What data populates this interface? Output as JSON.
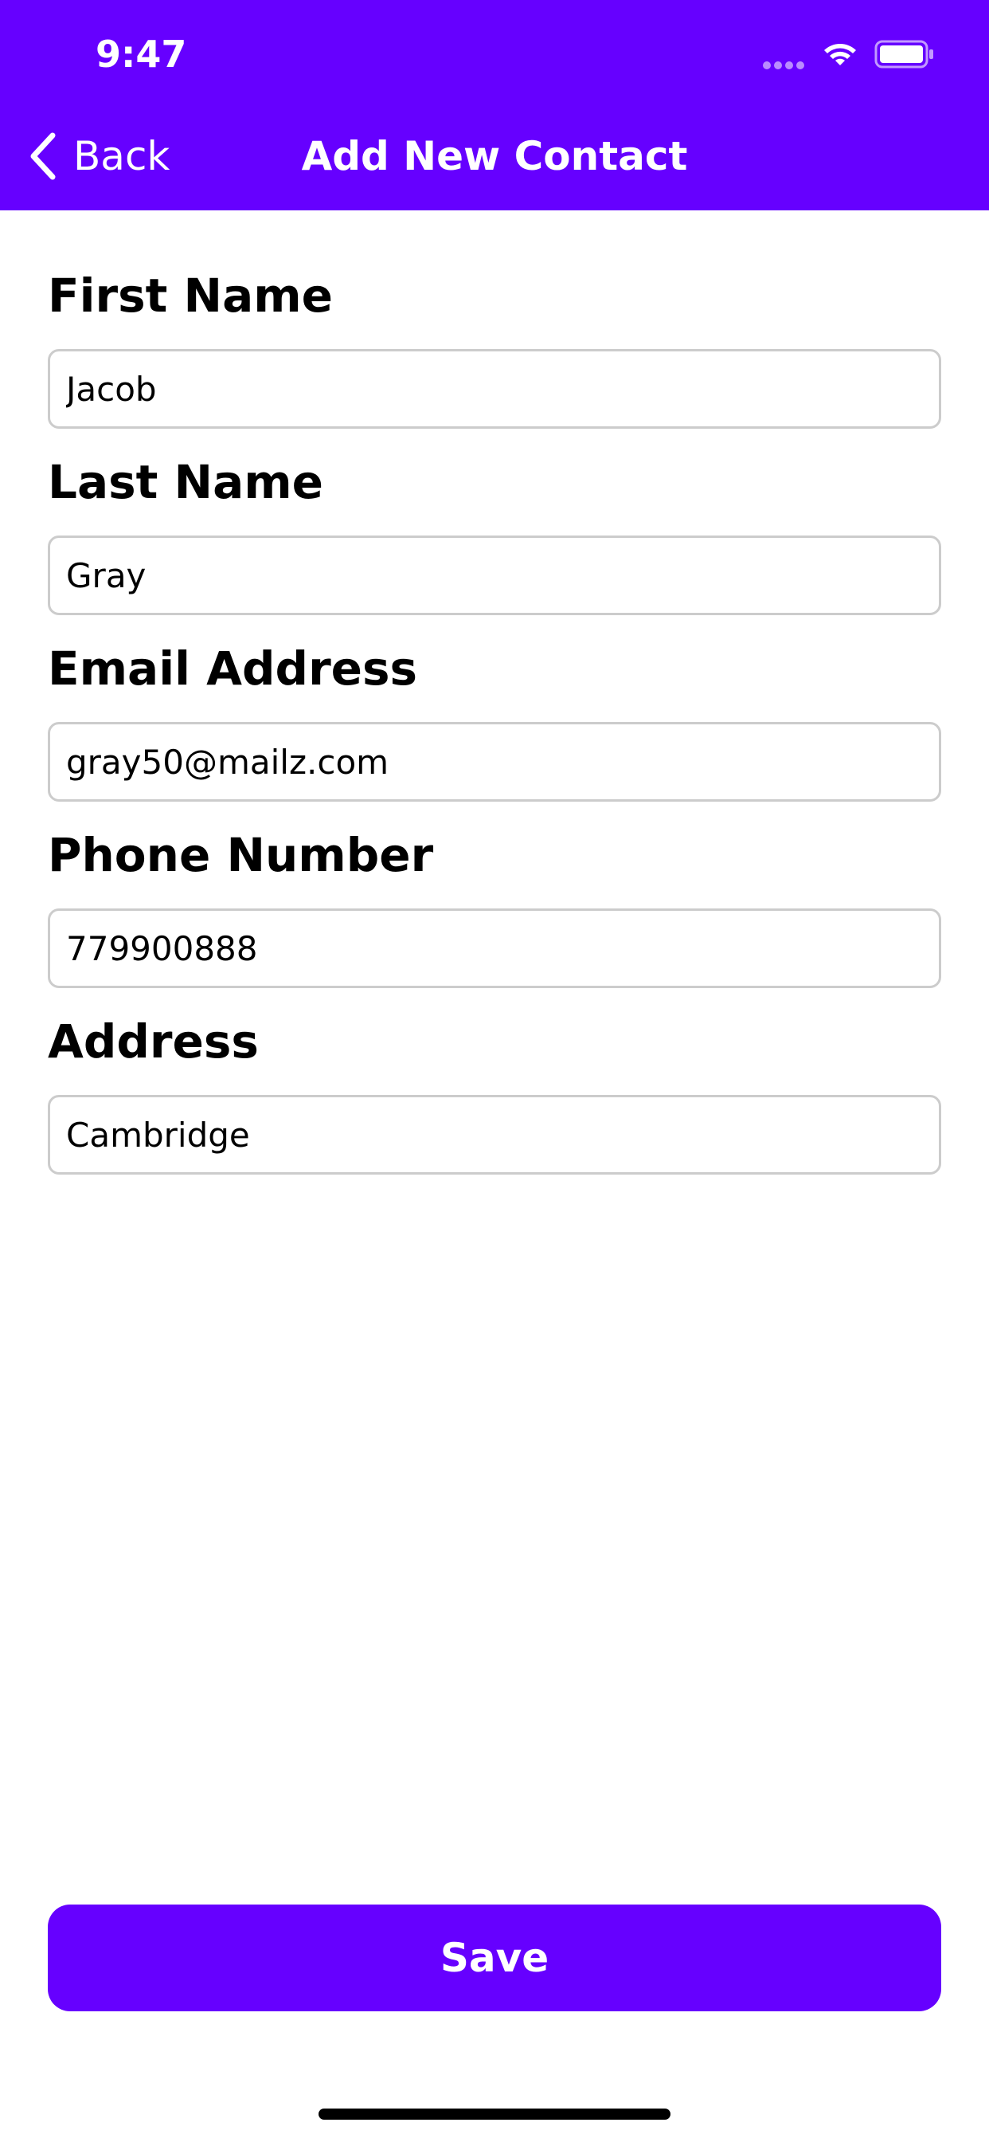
{
  "status_bar": {
    "time": "9:47"
  },
  "nav": {
    "back_label": "Back",
    "title": "Add New Contact"
  },
  "form": {
    "fields": [
      {
        "label": "First Name",
        "value": "Jacob"
      },
      {
        "label": "Last Name",
        "value": "Gray"
      },
      {
        "label": "Email Address",
        "value": "gray50@mailz.com"
      },
      {
        "label": "Phone Number",
        "value": "779900888"
      },
      {
        "label": "Address",
        "value": "Cambridge"
      }
    ]
  },
  "save_label": "Save",
  "colors": {
    "accent": "#6600ff",
    "input_border": "#cccccc",
    "text": "#000000"
  },
  "icons": {
    "back": "chevron-left-icon",
    "wifi": "wifi-icon",
    "battery": "battery-icon",
    "signal": "signal-dots-icon"
  }
}
